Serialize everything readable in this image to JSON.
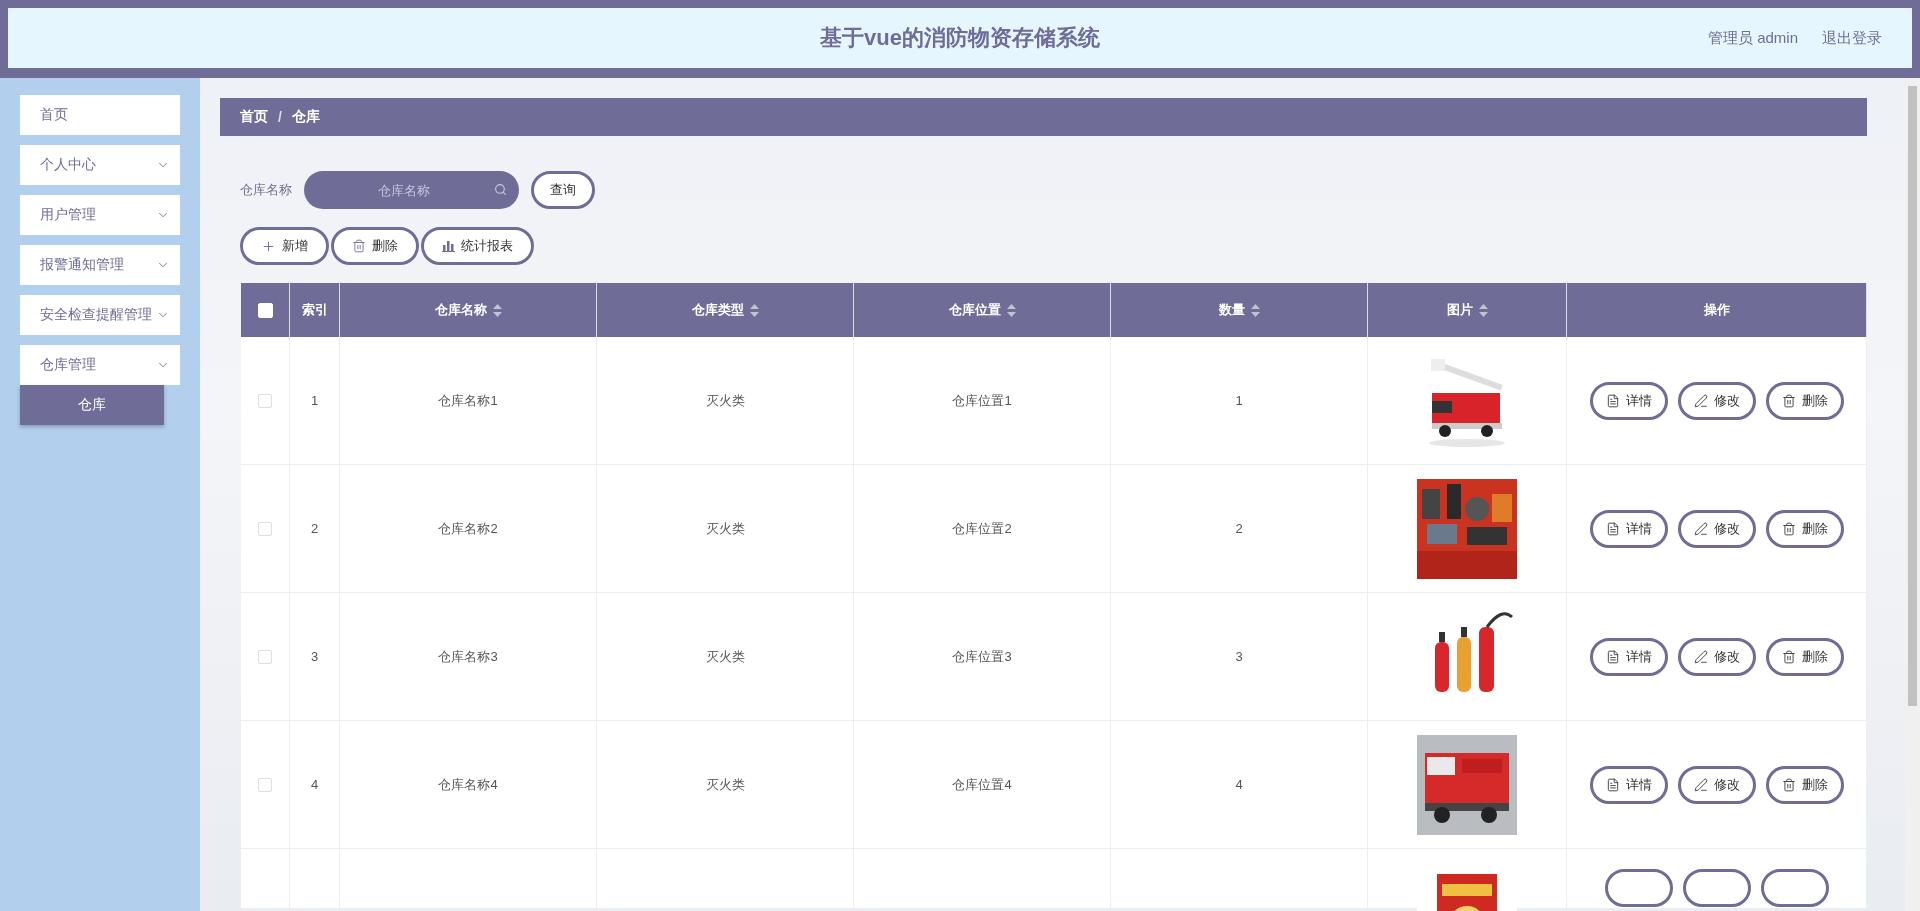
{
  "header": {
    "title": "基于vue的消防物资存储系统",
    "user": "管理员 admin",
    "logout": "退出登录"
  },
  "sidebar": {
    "items": [
      {
        "label": "首页",
        "expandable": false
      },
      {
        "label": "个人中心",
        "expandable": true
      },
      {
        "label": "用户管理",
        "expandable": true
      },
      {
        "label": "报警通知管理",
        "expandable": true
      },
      {
        "label": "安全检查提醒管理",
        "expandable": true
      },
      {
        "label": "仓库管理",
        "expandable": true,
        "children": [
          {
            "label": "仓库",
            "selected": true
          }
        ]
      }
    ]
  },
  "breadcrumb": [
    "首页",
    "仓库"
  ],
  "breadcrumb_separator": "/",
  "search": {
    "label": "仓库名称",
    "placeholder": "仓库名称",
    "button": "查询"
  },
  "actions": [
    {
      "kind": "add",
      "label": "新增"
    },
    {
      "kind": "delete",
      "label": "删除"
    },
    {
      "kind": "report",
      "label": "统计报表"
    }
  ],
  "table": {
    "columns": [
      {
        "kind": "checkbox",
        "checked": false
      },
      {
        "kind": "text",
        "label": "索引",
        "sortable": false
      },
      {
        "kind": "text",
        "label": "仓库名称",
        "sortable": true
      },
      {
        "kind": "text",
        "label": "仓库类型",
        "sortable": true
      },
      {
        "kind": "text",
        "label": "仓库位置",
        "sortable": true
      },
      {
        "kind": "text",
        "label": "数量",
        "sortable": true
      },
      {
        "kind": "text",
        "label": "图片",
        "sortable": true
      },
      {
        "kind": "text",
        "label": "操作",
        "sortable": false
      }
    ],
    "rows": [
      {
        "checked": false,
        "index": "1",
        "name": "仓库名称1",
        "type": "灭火类",
        "location": "仓库位置1",
        "quantity": "1",
        "image": {
          "kind": "picture"
        },
        "buttons": [
          {
            "kind": "detail",
            "label": "详情"
          },
          {
            "kind": "edit",
            "label": "修改"
          },
          {
            "kind": "delete",
            "label": "删除"
          }
        ]
      },
      {
        "checked": false,
        "index": "2",
        "name": "仓库名称2",
        "type": "灭火类",
        "location": "仓库位置2",
        "quantity": "2",
        "image": {
          "kind": "picture"
        },
        "buttons": [
          {
            "kind": "detail",
            "label": "详情"
          },
          {
            "kind": "edit",
            "label": "修改"
          },
          {
            "kind": "delete",
            "label": "删除"
          }
        ]
      },
      {
        "checked": false,
        "index": "3",
        "name": "仓库名称3",
        "type": "灭火类",
        "location": "仓库位置3",
        "quantity": "3",
        "image": {
          "kind": "picture"
        },
        "buttons": [
          {
            "kind": "detail",
            "label": "详情"
          },
          {
            "kind": "edit",
            "label": "修改"
          },
          {
            "kind": "delete",
            "label": "删除"
          }
        ]
      },
      {
        "checked": false,
        "index": "4",
        "name": "仓库名称4",
        "type": "灭火类",
        "location": "仓库位置4",
        "quantity": "4",
        "image": {
          "kind": "picture"
        },
        "buttons": [
          {
            "kind": "detail",
            "label": "详情"
          },
          {
            "kind": "edit",
            "label": "修改"
          },
          {
            "kind": "delete",
            "label": "删除"
          }
        ]
      }
    ],
    "partial_row": {
      "image": {
        "kind": "picture"
      }
    }
  }
}
